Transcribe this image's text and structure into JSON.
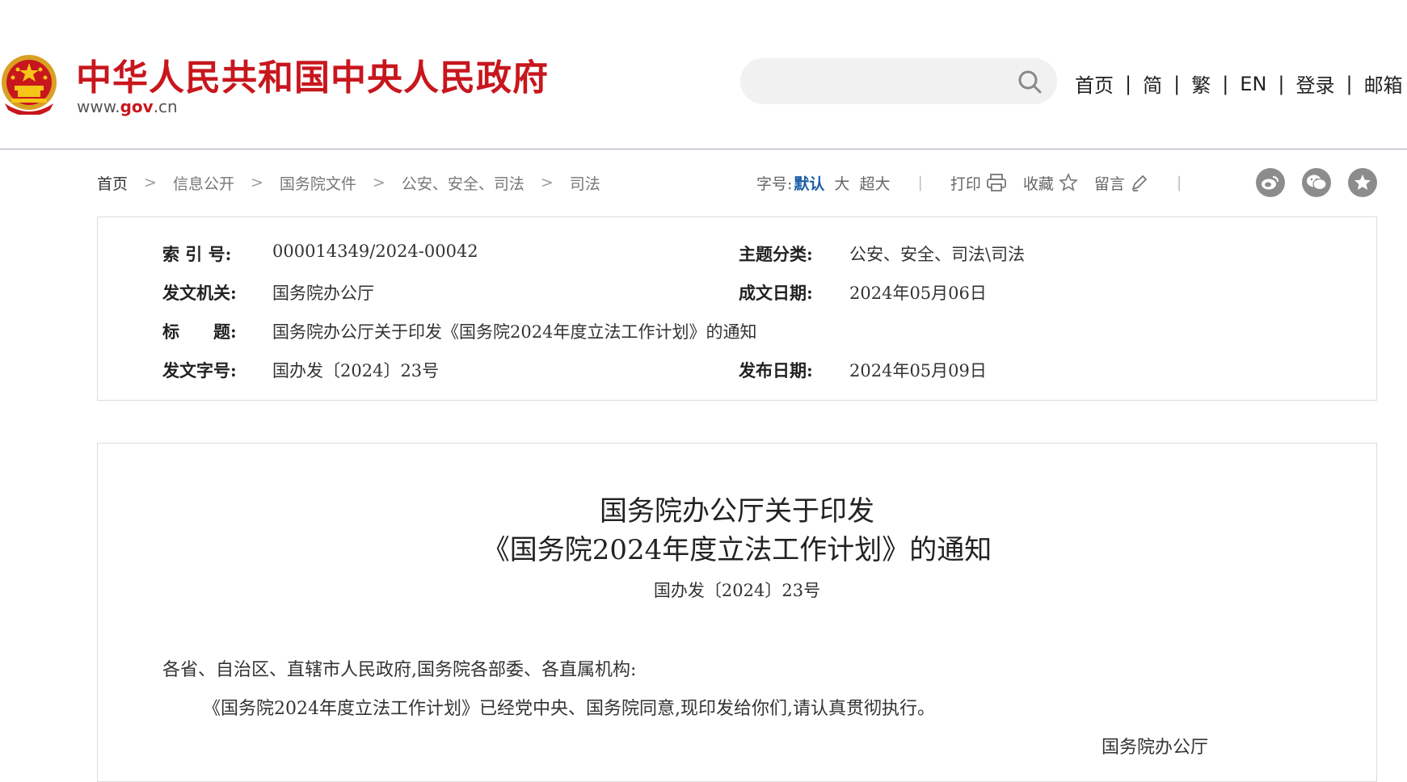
{
  "header": {
    "site_title": "中华人民共和国中央人民政府",
    "domain_prefix": "www.",
    "domain_gov": "gov",
    "domain_suffix": ".cn",
    "search_placeholder": "",
    "nav": [
      "首页",
      "简",
      "繁",
      "EN",
      "登录",
      "邮箱"
    ],
    "nav_separator": "|"
  },
  "breadcrumb": {
    "items": [
      "首页",
      "信息公开",
      "国务院文件",
      "公安、安全、司法",
      "司法"
    ],
    "arrow": ">"
  },
  "tools": {
    "font_label": "字号:",
    "font_default": "默认",
    "font_large": "大",
    "font_xlarge": "超大",
    "print": "打印",
    "favorite": "收藏",
    "comment": "留言",
    "separator": "|",
    "share_icons": [
      "weibo-icon",
      "wechat-icon",
      "qzone-icon"
    ]
  },
  "info": {
    "index_label": "索 引 号:",
    "index_value": "000014349/2024-00042",
    "topic_label": "主题分类:",
    "topic_value": "公安、安全、司法\\司法",
    "issuer_label": "发文机关:",
    "issuer_value": "国务院办公厅",
    "written_date_label": "成文日期:",
    "written_date_value": "2024年05月06日",
    "title_label": "标　　题:",
    "title_value": "国务院办公厅关于印发《国务院2024年度立法工作计划》的通知",
    "doc_no_label": "发文字号:",
    "doc_no_value": "国办发〔2024〕23号",
    "publish_date_label": "发布日期:",
    "publish_date_value": "2024年05月09日"
  },
  "document": {
    "title_line1": "国务院办公厅关于印发",
    "title_line2": "《国务院2024年度立法工作计划》的通知",
    "number": "国办发〔2024〕23号",
    "salutation": "各省、自治区、直辖市人民政府,国务院各部委、各直属机构:",
    "paragraph1": "《国务院2024年度立法工作计划》已经党中央、国务院同意,现印发给你们,请认真贯彻执行。",
    "signature": "国务院办公厅"
  },
  "colors": {
    "brand_red": "#c8161d",
    "link_blue": "#1b5ea6",
    "icon_gray": "#8c8c8c"
  }
}
